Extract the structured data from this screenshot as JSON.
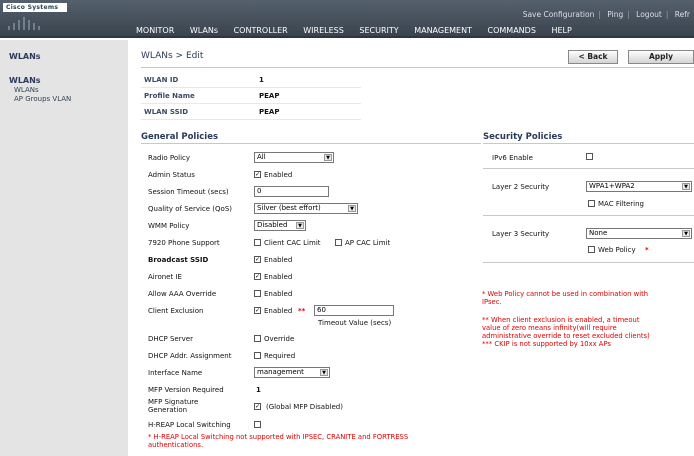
{
  "brand": {
    "logo_text": "Cisco Systems"
  },
  "toplinks": {
    "save": "Save Configuration",
    "ping": "Ping",
    "logout": "Logout",
    "refresh": "Refr"
  },
  "menu": {
    "monitor": "MONITOR",
    "wlans": "WLANs",
    "controller": "CONTROLLER",
    "wireless": "WIRELESS",
    "security": "SECURITY",
    "management": "MANAGEMENT",
    "commands": "COMMANDS",
    "help": "HELP"
  },
  "sidebar": {
    "top_title": "WLANs",
    "section_title": "WLANs",
    "items": [
      {
        "label": "WLANs"
      },
      {
        "label": "AP Groups VLAN"
      }
    ]
  },
  "page": {
    "breadcrumb": "WLANs > Edit",
    "back_label": "< Back",
    "apply_label": "Apply"
  },
  "wlan": {
    "id_label": "WLAN ID",
    "id_value": "1",
    "profile_label": "Profile Name",
    "profile_value": "PEAP",
    "ssid_label": "WLAN SSID",
    "ssid_value": "PEAP"
  },
  "general": {
    "title": "General Policies",
    "radio_policy": {
      "label": "Radio Policy",
      "value": "All"
    },
    "admin_status": {
      "label": "Admin Status",
      "checked": true,
      "text": "Enabled"
    },
    "session_timeout": {
      "label": "Session Timeout (secs)",
      "value": "0"
    },
    "qos": {
      "label": "Quality of Service (QoS)",
      "value": "Silver (best effort)"
    },
    "wmm": {
      "label": "WMM Policy",
      "value": "Disabled"
    },
    "phone": {
      "label": "7920 Phone Support",
      "client_cac": "Client CAC Limit",
      "ap_cac": "AP CAC Limit"
    },
    "broadcast_ssid": {
      "label": "Broadcast SSID",
      "checked": true,
      "text": "Enabled"
    },
    "aironet": {
      "label": "Aironet IE",
      "checked": true,
      "text": "Enabled"
    },
    "aaa_override": {
      "label": "Allow AAA Override",
      "checked": false,
      "text": "Enabled"
    },
    "client_exclusion": {
      "label": "Client Exclusion",
      "checked": true,
      "text": "Enabled",
      "stars": "**",
      "timeout_value": "60",
      "timeout_label": "Timeout Value (secs)"
    },
    "dhcp_server": {
      "label": "DHCP Server",
      "text": "Override"
    },
    "dhcp_addr": {
      "label": "DHCP Addr. Assignment",
      "text": "Required"
    },
    "interface": {
      "label": "Interface Name",
      "value": "management"
    },
    "mfp_version": {
      "label": "MFP Version Required",
      "value": "1"
    },
    "mfp_sig": {
      "label_line1": "MFP Signature",
      "label_line2": "Generation",
      "text": "(Global MFP Disabled)"
    },
    "hreap": {
      "label": "H-REAP Local Switching"
    },
    "hreap_note_line1": "* H-REAP Local Switching not supported with IPSEC, CRANITE and FORTRESS",
    "hreap_note_line2": "authentications."
  },
  "security": {
    "title": "Security Policies",
    "ipv6": {
      "label": "IPv6 Enable"
    },
    "layer2": {
      "label": "Layer 2 Security",
      "value": "WPA1+WPA2",
      "mac_filter": "MAC Filtering"
    },
    "layer3": {
      "label": "Layer 3 Security",
      "value": "None",
      "web_policy": "Web Policy",
      "star": "*"
    },
    "note1_line1": "* Web Policy cannot be used in combination with",
    "note1_line2": "IPsec.",
    "note2_line1": "** When client exclusion is enabled, a timeout",
    "note2_line2": "value of zero means infinity(will require",
    "note2_line3": "administrative override to reset excluded clients)",
    "note3": "*** CKIP is not supported by 10xx APs"
  },
  "colors": {
    "nav_bg": "#3a444f",
    "sidebar_bg": "#e4e4e4",
    "title_blue": "#2a3a5a",
    "note_red": "#d00000"
  }
}
